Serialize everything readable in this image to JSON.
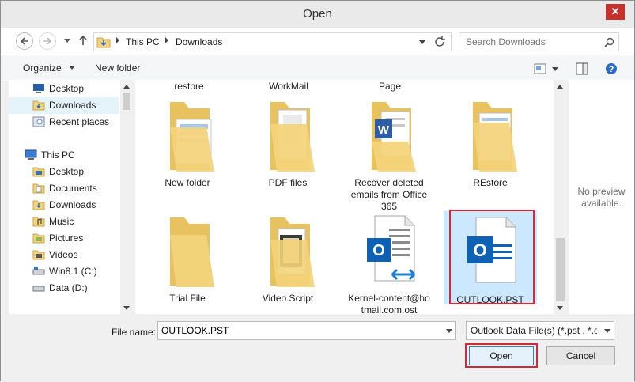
{
  "window": {
    "title": "Open",
    "close_glyph": "✕"
  },
  "address": {
    "crumbs": [
      "This PC",
      "Downloads"
    ]
  },
  "search": {
    "placeholder": "Search Downloads"
  },
  "toolbar": {
    "organize_label": "Organize",
    "new_folder_label": "New folder"
  },
  "nav_pane": {
    "favorites": [
      {
        "label": "Desktop",
        "icon": "desktop-icon"
      },
      {
        "label": "Downloads",
        "icon": "downloads-folder-icon",
        "selected": true
      },
      {
        "label": "Recent places",
        "icon": "recent-places-icon"
      }
    ],
    "this_pc_label": "This PC",
    "this_pc_items": [
      {
        "label": "Desktop",
        "icon": "folder-icon"
      },
      {
        "label": "Documents",
        "icon": "folder-icon"
      },
      {
        "label": "Downloads",
        "icon": "folder-icon"
      },
      {
        "label": "Music",
        "icon": "folder-icon"
      },
      {
        "label": "Pictures",
        "icon": "folder-icon"
      },
      {
        "label": "Videos",
        "icon": "folder-icon"
      },
      {
        "label": "Win8.1 (C:)",
        "icon": "drive-icon"
      },
      {
        "label": "Data (D:)",
        "icon": "drive-icon"
      }
    ]
  },
  "files": {
    "top_partial_labels": [
      "restore",
      "WorkMail",
      "Page"
    ],
    "row1": [
      {
        "name": "New folder",
        "icon": "folder-icon"
      },
      {
        "name": "PDF files",
        "icon": "folder-icon"
      },
      {
        "name": "Recover deleted emails from Office 365",
        "icon": "folder-word-icon"
      },
      {
        "name": "REstore",
        "icon": "folder-icon"
      }
    ],
    "row2": [
      {
        "name": "Trial File",
        "icon": "folder-icon"
      },
      {
        "name": "Video Script",
        "icon": "folder-icon"
      },
      {
        "name": "Kernel-content@hotmail.com.ost",
        "icon": "ost-file-icon"
      },
      {
        "name": "OUTLOOK.PST",
        "icon": "pst-file-icon",
        "selected": true
      }
    ]
  },
  "preview": {
    "text": "No preview available."
  },
  "bottom": {
    "file_name_label": "File name:",
    "file_name_value": "OUTLOOK.PST",
    "filter_value": "Outlook Data File(s) (*.pst , *.ost)",
    "open_label": "Open",
    "cancel_label": "Cancel"
  },
  "colors": {
    "highlight": "#d0293a",
    "outlook_blue": "#0f62b3",
    "folder": "#f3d37a"
  }
}
